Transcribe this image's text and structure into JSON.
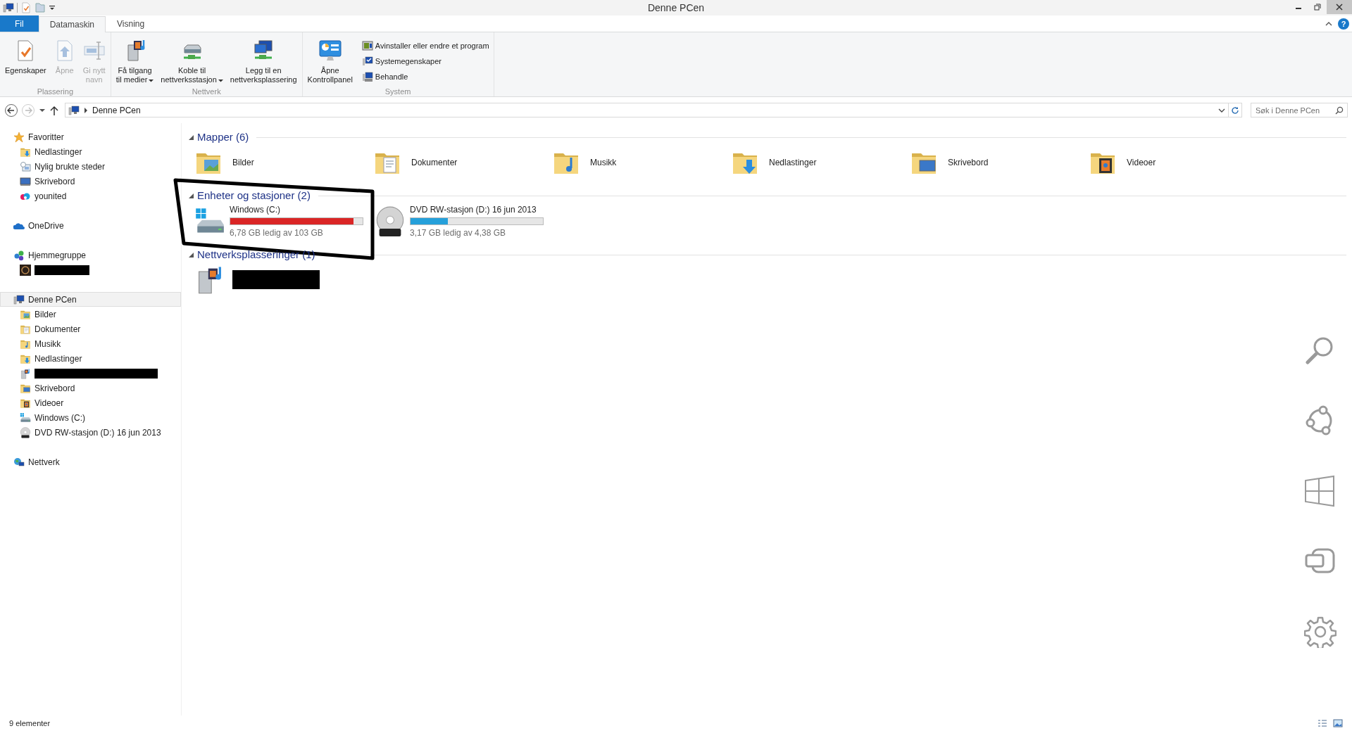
{
  "window": {
    "title": "Denne PCen"
  },
  "ribbon": {
    "tabs": [
      {
        "label": "Fil",
        "kind": "file",
        "selected": false
      },
      {
        "label": "Datamaskin",
        "kind": "tab",
        "selected": true
      },
      {
        "label": "Visning",
        "kind": "tab",
        "selected": false
      }
    ],
    "help": "?",
    "groups": [
      {
        "label": "Plassering",
        "buttons": [
          {
            "lines": [
              "Egenskaper"
            ],
            "disabled": false,
            "dropdown": false
          },
          {
            "lines": [
              "Åpne"
            ],
            "disabled": true,
            "dropdown": false
          },
          {
            "lines": [
              "Gi nytt",
              "navn"
            ],
            "disabled": true,
            "dropdown": false
          }
        ]
      },
      {
        "label": "Nettverk",
        "buttons": [
          {
            "lines": [
              "Få tilgang",
              "til medier"
            ],
            "disabled": false,
            "dropdown": true
          },
          {
            "lines": [
              "Koble til",
              "nettverksstasjon"
            ],
            "disabled": false,
            "dropdown": true
          },
          {
            "lines": [
              "Legg til en",
              "nettverksplassering"
            ],
            "disabled": false,
            "dropdown": false
          }
        ]
      },
      {
        "label": "System",
        "buttons": [
          {
            "lines": [
              "Åpne",
              "Kontrollpanel"
            ],
            "disabled": false,
            "dropdown": false
          }
        ],
        "small_buttons": [
          "Avinstaller eller endre et program",
          "Systemegenskaper",
          "Behandle"
        ]
      }
    ]
  },
  "address_bar": {
    "path": [
      "Denne PCen"
    ],
    "search_placeholder": "Søk i Denne PCen"
  },
  "navigation": [
    {
      "label": "Favoritter",
      "kind": "item",
      "selected": false,
      "children": [
        {
          "label": "Nedlastinger",
          "kind": "item",
          "selected": false
        },
        {
          "label": "Nylig brukte steder",
          "kind": "item",
          "selected": false
        },
        {
          "label": "Skrivebord",
          "kind": "item",
          "selected": false
        },
        {
          "label": "younited",
          "kind": "item",
          "selected": false
        }
      ]
    },
    {
      "label": "OneDrive",
      "kind": "item",
      "selected": false
    },
    {
      "label": "Hjemmegruppe",
      "kind": "item",
      "selected": false,
      "children": [
        {
          "kind": "redacted",
          "selected": false
        }
      ]
    },
    {
      "label": "Denne PCen",
      "kind": "item",
      "selected": true,
      "children": [
        {
          "label": "Bilder",
          "kind": "item",
          "selected": false
        },
        {
          "label": "Dokumenter",
          "kind": "item",
          "selected": false
        },
        {
          "label": "Musikk",
          "kind": "item",
          "selected": false
        },
        {
          "label": "Nedlastinger",
          "kind": "item",
          "selected": false
        },
        {
          "kind": "redacted",
          "selected": false
        },
        {
          "label": "Skrivebord",
          "kind": "item",
          "selected": false
        },
        {
          "label": "Videoer",
          "kind": "item",
          "selected": false
        },
        {
          "label": "Windows (C:)",
          "kind": "item",
          "selected": false
        },
        {
          "label": "DVD RW-stasjon (D:) 16 jun 2013",
          "kind": "item",
          "selected": false
        }
      ]
    },
    {
      "label": "Nettverk",
      "kind": "item",
      "selected": false
    }
  ],
  "content_groups": [
    {
      "title": "Mapper (6)",
      "expanded": true,
      "items": [
        {
          "kind": "folder",
          "name": "Bilder"
        },
        {
          "kind": "folder",
          "name": "Dokumenter"
        },
        {
          "kind": "folder",
          "name": "Musikk"
        },
        {
          "kind": "folder",
          "name": "Nedlastinger"
        },
        {
          "kind": "folder",
          "name": "Skrivebord"
        },
        {
          "kind": "folder",
          "name": "Videoer"
        }
      ]
    },
    {
      "title": "Enheter og stasjoner (2)",
      "expanded": true,
      "items": [
        {
          "kind": "drive",
          "name": "Windows (C:)",
          "level": 0.93,
          "color": "#da2626",
          "free": "6,78 GB ledig av 103 GB"
        },
        {
          "kind": "drive",
          "name": "DVD RW-stasjon (D:) 16 jun 2013",
          "level": 0.28,
          "color": "#26a0da",
          "free": "3,17 GB ledig av 4,38 GB"
        }
      ]
    },
    {
      "title": "Nettverksplasseringer (1)",
      "expanded": true,
      "items": [
        {
          "kind": "redacted"
        }
      ]
    }
  ],
  "status_bar": {
    "count": "9 elementer"
  }
}
